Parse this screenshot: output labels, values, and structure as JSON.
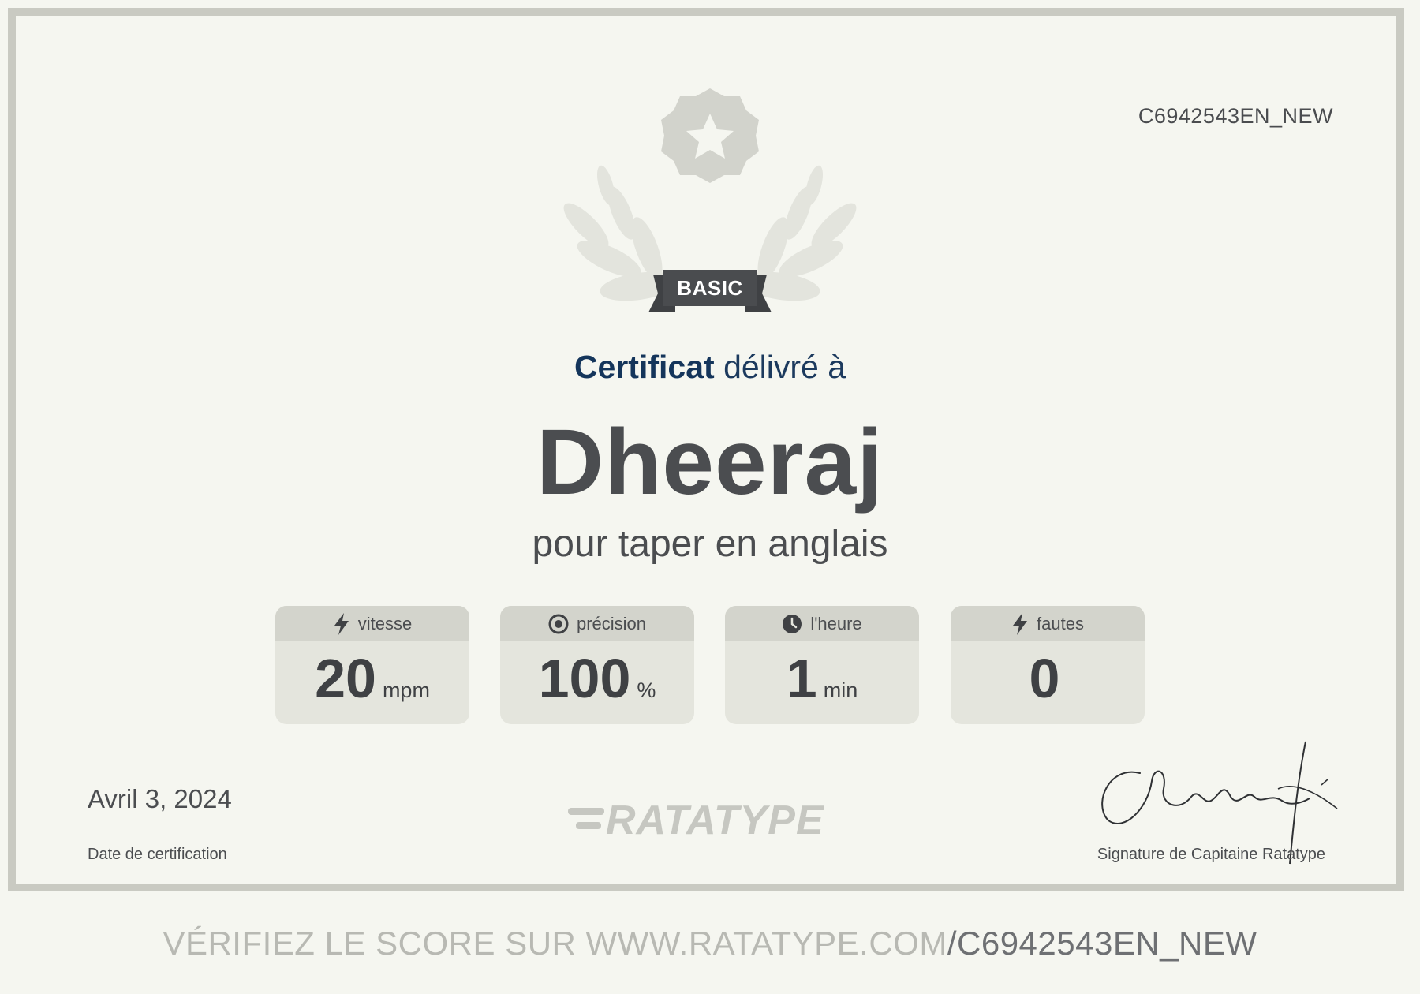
{
  "certificate": {
    "id": "C6942543EN_NEW",
    "level_badge": "BASIC",
    "delivered_strong": "Certificat",
    "delivered_rest": "délivré à",
    "recipient": "Dheeraj",
    "subject": "pour taper en anglais"
  },
  "stats": [
    {
      "label": "vitesse",
      "value": "20",
      "unit": "mpm",
      "icon": "lightning-icon"
    },
    {
      "label": "précision",
      "value": "100",
      "unit": "%",
      "icon": "target-icon"
    },
    {
      "label": "l'heure",
      "value": "1",
      "unit": "min",
      "icon": "clock-icon"
    },
    {
      "label": "fautes",
      "value": "0",
      "unit": "",
      "icon": "lightning-icon"
    }
  ],
  "footer": {
    "date": "Avril 3, 2024",
    "date_label": "Date de certification",
    "logo_text": "RATATYPE",
    "signature_label": "Signature de Capitaine Ratatype"
  },
  "verify": {
    "prefix": "VÉRIFIEZ LE SCORE SUR WWW.RATATYPE.COM",
    "code": "/C6942543EN_NEW"
  },
  "colors": {
    "background": "#f5f6f0",
    "frame": "#c9cac2",
    "heading_blue": "#14355b",
    "text_dark": "#4b4d50",
    "badge_dark": "#4a4c4f"
  }
}
